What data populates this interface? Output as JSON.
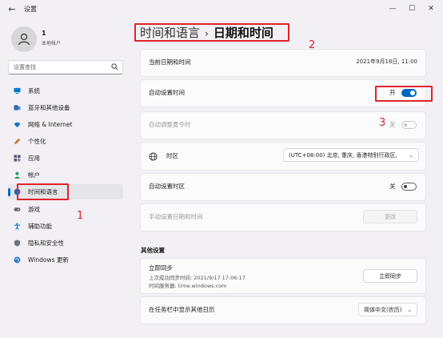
{
  "window": {
    "title": "设置",
    "back_glyph": "←",
    "minimize_glyph": "—",
    "maximize_glyph": "☐",
    "close_glyph": "✕"
  },
  "user": {
    "name": "1",
    "account_type": "本地帐户"
  },
  "search": {
    "placeholder": "设置查找"
  },
  "sidebar": {
    "items": [
      {
        "label": "系统",
        "icon": "monitor-icon",
        "color": "#0078d4"
      },
      {
        "label": "蓝牙和其他设备",
        "icon": "bluetooth-icon",
        "color": "#2b6cb0"
      },
      {
        "label": "网络 & Internet",
        "icon": "wifi-icon",
        "color": "#1a73c4"
      },
      {
        "label": "个性化",
        "icon": "pen-icon",
        "color": "#c7702c"
      },
      {
        "label": "应用",
        "icon": "apps-icon",
        "color": "#5a5a78"
      },
      {
        "label": "帐户",
        "icon": "person-icon",
        "color": "#2a9d5c"
      },
      {
        "label": "时间和语言",
        "icon": "globe-clock-icon",
        "color": "#0f6cbd",
        "active": true
      },
      {
        "label": "游戏",
        "icon": "game-icon",
        "color": "#6b6b6b"
      },
      {
        "label": "辅助功能",
        "icon": "accessibility-icon",
        "color": "#1f77d0"
      },
      {
        "label": "隐私和安全性",
        "icon": "shield-icon",
        "color": "#6f7480"
      },
      {
        "label": "Windows 更新",
        "icon": "update-icon",
        "color": "#1a73c4"
      }
    ]
  },
  "breadcrumb": {
    "parent": "时间和语言",
    "separator": "›",
    "current": "日期和时间"
  },
  "settings": {
    "current_datetime": {
      "label": "当前日期和时间",
      "value": "2021年9月18日, 11:00"
    },
    "auto_time": {
      "label": "自动设置时间",
      "state": "开",
      "on": true
    },
    "dst": {
      "label": "自动调整夏令时",
      "state": "关",
      "disabled": true
    },
    "timezone": {
      "label": "时区",
      "value": "(UTC+08:00) 北京, 重庆, 香港特别行政区,",
      "icon": "timezone-icon"
    },
    "auto_timezone": {
      "label": "自动设置时区",
      "state": "关",
      "on": false
    },
    "manual": {
      "label": "手动设置日期和时间",
      "button": "更改",
      "disabled": true
    }
  },
  "other": {
    "heading": "其他设置",
    "sync": {
      "title": "立即同步",
      "last_sync": "上次成功同步时间: 2021/9/17 17:06:17",
      "server": "时间服务器: time.windows.com",
      "button": "立即同步"
    },
    "calendar": {
      "label": "在任务栏中显示其他日历",
      "value": "简体中文(农历)"
    }
  },
  "annotations": {
    "n1": "1",
    "n2": "2",
    "n3": "3"
  },
  "colors": {
    "accent": "#0067c0",
    "annotation": "#e0242b"
  }
}
